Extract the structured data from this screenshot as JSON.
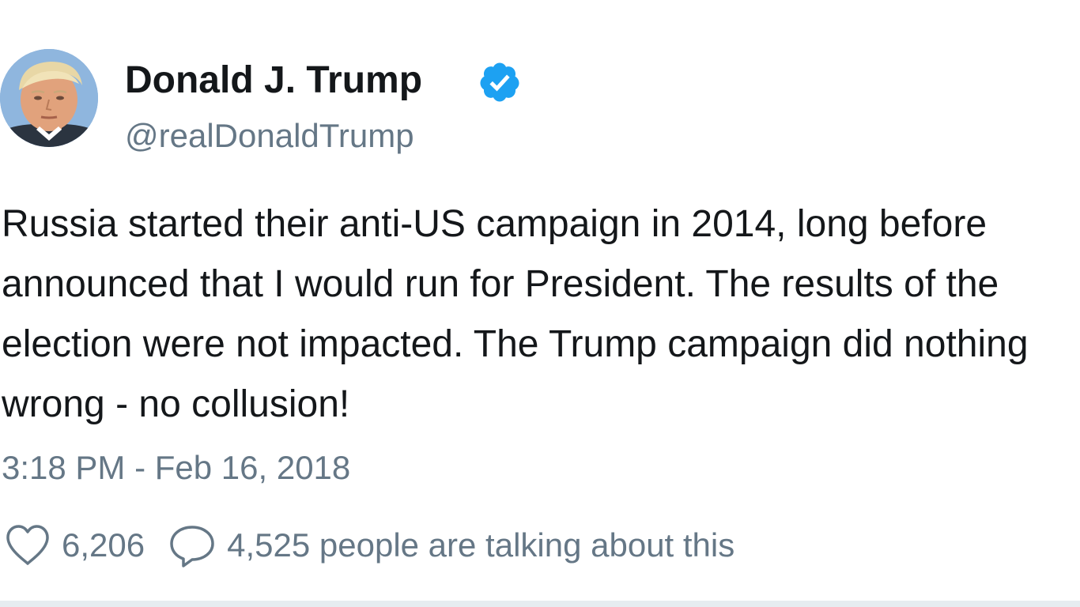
{
  "tweet": {
    "author_name": "Donald J. Trump",
    "handle": "@realDonaldTrump",
    "text_lines": [
      "Russia started their anti-US campaign in 2014, long before",
      "announced that I would run for President. The results of the",
      "election were not impacted. The Trump campaign did nothing",
      "wrong - no collusion!"
    ],
    "timestamp": "3:18 PM - Feb 16, 2018",
    "likes": "6,206",
    "talking": "4,525 people are talking about this"
  },
  "icons": {
    "verified": "verified-badge-icon",
    "like": "heart-icon",
    "reply": "speech-bubble-icon",
    "avatar": "profile-photo"
  },
  "colors": {
    "text": "#14171a",
    "secondary": "#657786",
    "verified_blue": "#1da1f2",
    "divider": "#e6ecf0"
  }
}
